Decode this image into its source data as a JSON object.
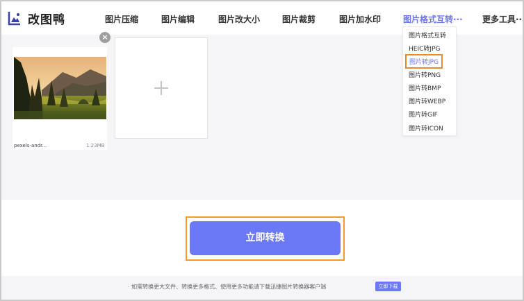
{
  "app": {
    "logo_text": "改图鸭"
  },
  "nav": [
    {
      "label": "图片压缩"
    },
    {
      "label": "图片编辑"
    },
    {
      "label": "图片改大小"
    },
    {
      "label": "图片裁剪"
    },
    {
      "label": "图片加水印"
    },
    {
      "label": "图片格式互转···"
    },
    {
      "label": "更多工具···"
    }
  ],
  "dropdown": {
    "items": [
      {
        "label": "图片格式互转"
      },
      {
        "label": "HEIC转JPG"
      },
      {
        "label": "图片转JPG"
      },
      {
        "label": "图片转PNG"
      },
      {
        "label": "图片转BMP"
      },
      {
        "label": "图片转WEBP"
      },
      {
        "label": "图片转GIF"
      },
      {
        "label": "图片转ICON"
      }
    ],
    "selected_index": 2
  },
  "file": {
    "name": "pexels-andr...",
    "size": "1.23MB"
  },
  "actions": {
    "close_symbol": "×",
    "convert_label": "立即转换"
  },
  "footer": {
    "text": "· 如需转换更大文件、转换更多格式、使用更多功能请下载迅捷图片转换器客户端",
    "download_label": "立即下载"
  },
  "colors": {
    "accent": "#6b79f7",
    "highlight": "#f39b2a",
    "panel_bg": "#f5f5f7"
  }
}
